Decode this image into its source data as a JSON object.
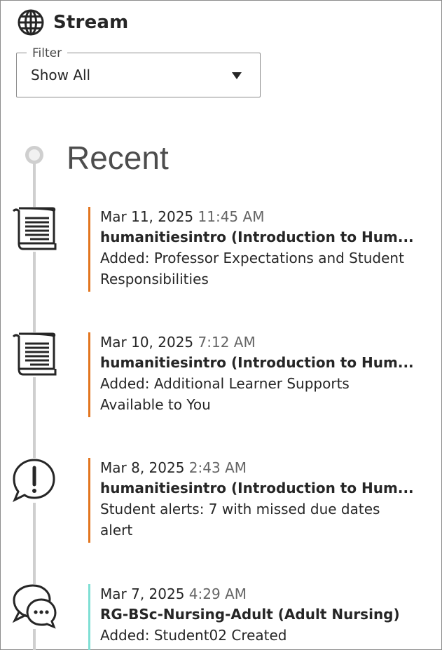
{
  "header": {
    "title": "Stream",
    "icon": "globe-icon"
  },
  "filter": {
    "label": "Filter",
    "value": "Show All"
  },
  "section": {
    "heading": "Recent"
  },
  "colors": {
    "accent_orange": "#e2751f",
    "accent_teal": "#7fdfd4",
    "timeline": "#cfcfcf"
  },
  "items": [
    {
      "icon": "document-icon",
      "date": "Mar 11, 2025",
      "time": "11:45 AM",
      "course": "humanitiesintro (Introduction to Hum...",
      "description": "Added: Professor Expectations and Student Responsibilities"
    },
    {
      "icon": "document-icon",
      "date": "Mar 10, 2025",
      "time": "7:12 AM",
      "course": "humanitiesintro (Introduction to Hum...",
      "description": "Added: Additional Learner Supports Available to You"
    },
    {
      "icon": "alert-bubble-icon",
      "date": "Mar 8, 2025",
      "time": "2:43 AM",
      "course": "humanitiesintro (Introduction to Hum...",
      "description": "Student alerts: 7 with missed due dates alert"
    },
    {
      "icon": "discussion-bubbles-icon",
      "date": "Mar 7, 2025",
      "time": "4:29 AM",
      "course": "RG-BSc-Nursing-Adult (Adult Nursing)",
      "description": "Added: Student02 Created"
    }
  ]
}
